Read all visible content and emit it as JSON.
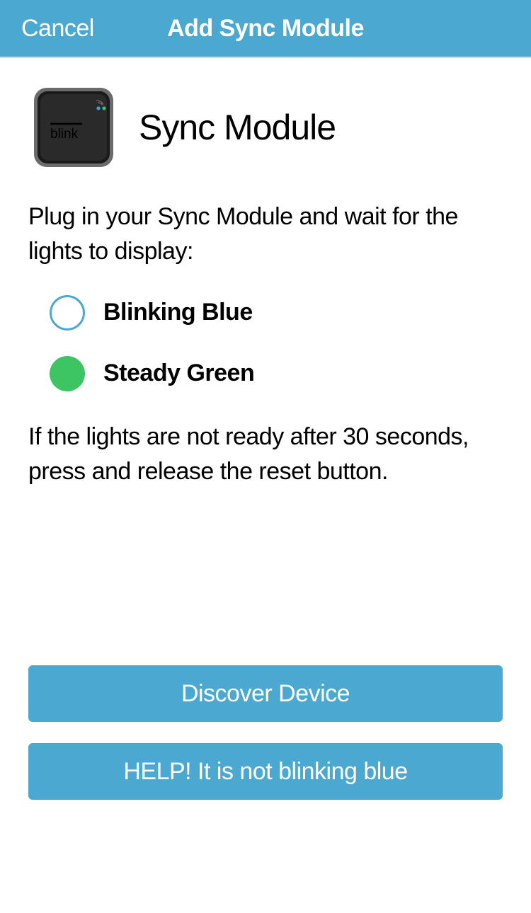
{
  "navbar": {
    "cancel_label": "Cancel",
    "title": "Add Sync Module"
  },
  "hero": {
    "title": "Sync Module",
    "device_brand": "blink"
  },
  "instruction_primary": "Plug in your Sync Module and wait for the lights to display:",
  "status": [
    {
      "label": "Blinking Blue",
      "style": "ring"
    },
    {
      "label": "Steady Green",
      "style": "green"
    }
  ],
  "instruction_secondary": "If the lights are not ready after 30 seconds, press and release the reset button.",
  "buttons": {
    "discover_label": "Discover Device",
    "help_label": "HELP! It is not blinking blue"
  },
  "colors": {
    "accent": "#4ba8d0",
    "green": "#3dc463"
  }
}
